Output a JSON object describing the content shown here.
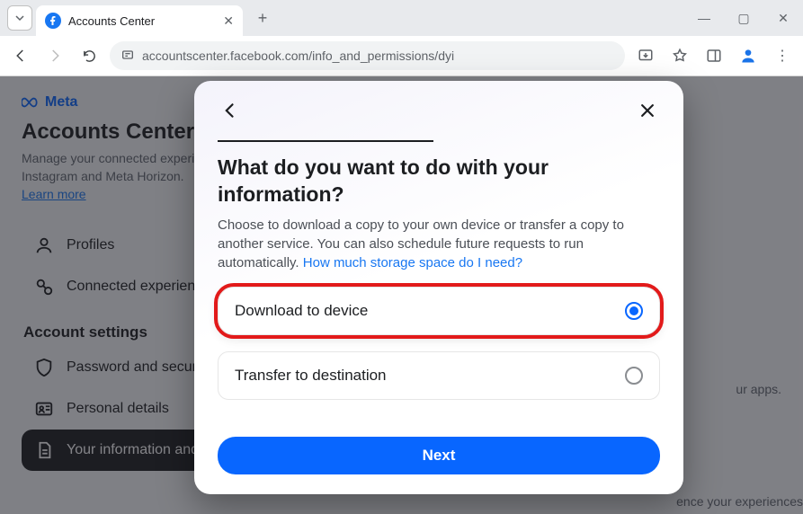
{
  "browser": {
    "tab_title": "Accounts Center",
    "url": "accountscenter.facebook.com/info_and_permissions/dyi"
  },
  "page": {
    "brand": "Meta",
    "title": "Accounts Center",
    "description": "Manage your connected experiences and account settings across Meta technologies like Facebook, Instagram and Meta Horizon.",
    "learn_more": "Learn more",
    "sidebar": {
      "profiles": "Profiles",
      "connected": "Connected experiences",
      "section": "Account settings",
      "password": "Password and security",
      "personal": "Personal details",
      "info_perms": "Your information and permissions"
    },
    "hint1": "ur apps.",
    "hint2": "ence your experiences"
  },
  "modal": {
    "title": "What do you want to do with your information?",
    "description_pre": "Choose to download a copy to your own device or transfer a copy to another service. You can also schedule future requests to run automatically. ",
    "storage_link": "How much storage space do I need?",
    "option1": "Download to device",
    "option2": "Transfer to destination",
    "next": "Next"
  }
}
